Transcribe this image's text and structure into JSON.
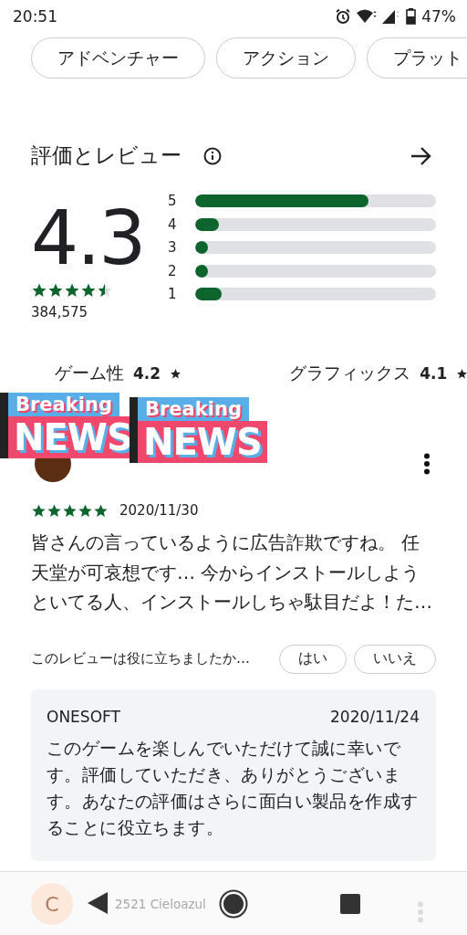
{
  "status_bar": {
    "time": "20:51",
    "battery": "47%"
  },
  "genre_chips": [
    "アドベンチャー",
    "アクション",
    "プラット"
  ],
  "ratings": {
    "title": "評価とレビュー",
    "score": "4.3",
    "stars": 4.5,
    "count": "384,575",
    "distribution": [
      {
        "label": "5",
        "level": 0.72
      },
      {
        "label": "4",
        "level": 0.1
      },
      {
        "label": "3",
        "level": 0.05
      },
      {
        "label": "2",
        "level": 0.05
      },
      {
        "label": "1",
        "level": 0.11
      }
    ]
  },
  "category_ratings": [
    {
      "label": "ゲーム性",
      "value": "4.2"
    },
    {
      "label": "グラフィックス",
      "value": "4.1"
    }
  ],
  "stickers": [
    {
      "top": "Breaking",
      "bottom": "NEWS"
    },
    {
      "top": "Breaking",
      "bottom": "NEWS"
    }
  ],
  "review": {
    "stars": 5,
    "date": "2020/11/30",
    "text": "皆さんの言っているように広告詐欺ですね。 任天堂が可哀想です… 今からインストールしようといてる人、インストールしちゃ駄目だよ！た…",
    "helpful_prompt": "このレビューは役に立ちましたか…",
    "buttons": [
      "はい",
      "いいえ"
    ],
    "reply": {
      "author": "ONESOFT",
      "date": "2020/11/24",
      "text": "このゲームを楽しんでいただけて誠に幸いです。評価していただき、ありがとうございます。あなたの評価はさらに面白い製品を作成することに役立ちます。"
    }
  },
  "next_review": {
    "avatar_letter": "C",
    "author": "2521 Cieloazul"
  }
}
